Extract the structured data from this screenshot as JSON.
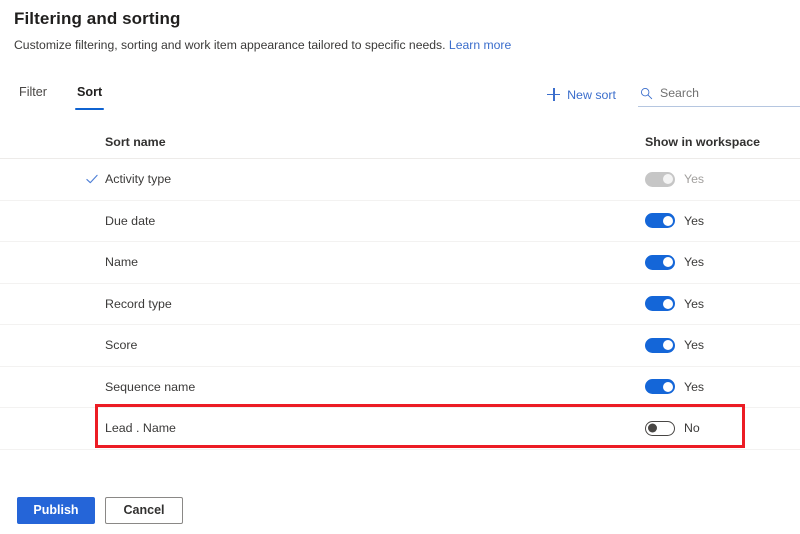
{
  "header": {
    "title": "Filtering and sorting",
    "subtitle": "Customize filtering, sorting and work item appearance tailored to specific needs.",
    "link_label": "Learn more"
  },
  "toolbar": {
    "tabs": [
      {
        "label": "Filter",
        "active": false
      },
      {
        "label": "Sort",
        "active": true
      }
    ],
    "new_sort_label": "New sort",
    "search": {
      "placeholder": "Search",
      "value": ""
    }
  },
  "table": {
    "columns": {
      "name": "Sort name",
      "toggle": "Show in workspace"
    },
    "rows": [
      {
        "name": "Activity type",
        "checked": true,
        "toggle_state": "on-disabled",
        "toggle_label": "Yes",
        "highlighted": false
      },
      {
        "name": "Due date",
        "checked": false,
        "toggle_state": "on",
        "toggle_label": "Yes",
        "highlighted": false
      },
      {
        "name": "Name",
        "checked": false,
        "toggle_state": "on",
        "toggle_label": "Yes",
        "highlighted": false
      },
      {
        "name": "Record type",
        "checked": false,
        "toggle_state": "on",
        "toggle_label": "Yes",
        "highlighted": false
      },
      {
        "name": "Score",
        "checked": false,
        "toggle_state": "on",
        "toggle_label": "Yes",
        "highlighted": false
      },
      {
        "name": "Sequence name",
        "checked": false,
        "toggle_state": "on",
        "toggle_label": "Yes",
        "highlighted": false
      },
      {
        "name": "Lead . Name",
        "checked": false,
        "toggle_state": "off",
        "toggle_label": "No",
        "highlighted": true
      }
    ]
  },
  "footer": {
    "publish_label": "Publish",
    "cancel_label": "Cancel"
  },
  "colors": {
    "accent": "#1466d8",
    "link": "#3b6ecc",
    "tab_underline": "#0f63d1",
    "highlight": "#ec1c24",
    "toggle_on": "#1466d8",
    "toggle_disabled": "#c6c6c6",
    "primary_button": "#2565d8"
  }
}
